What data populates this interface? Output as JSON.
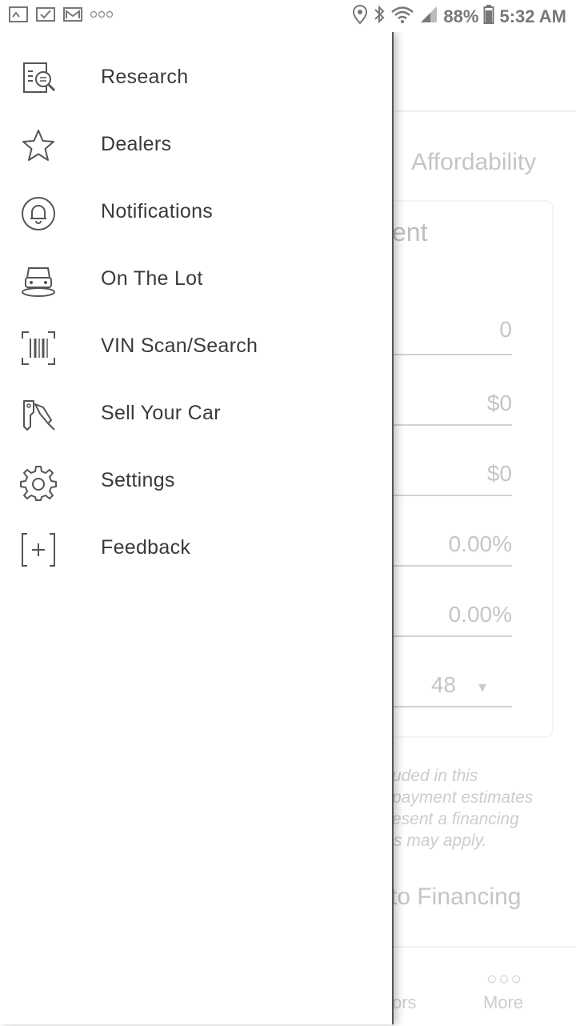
{
  "status_bar": {
    "battery": "88%",
    "time": "5:32 AM"
  },
  "drawer": {
    "items": [
      {
        "label": "Research",
        "icon": "research-icon"
      },
      {
        "label": "Dealers",
        "icon": "star-icon"
      },
      {
        "label": "Notifications",
        "icon": "bell-icon"
      },
      {
        "label": "On The Lot",
        "icon": "car-icon"
      },
      {
        "label": "VIN Scan/Search",
        "icon": "barcode-icon"
      },
      {
        "label": "Sell Your Car",
        "icon": "key-icon"
      },
      {
        "label": "Settings",
        "icon": "gear-icon"
      },
      {
        "label": "Feedback",
        "icon": "feedback-icon"
      }
    ]
  },
  "background": {
    "tab_label": "Affordability",
    "card_title_fragment": "ent",
    "fields": [
      "0",
      "$0",
      "$0",
      "0.00%",
      "0.00%",
      "48"
    ],
    "disclaimer_lines": [
      "uded in this",
      "payment estimates",
      "esent a financing",
      "s may apply."
    ],
    "financing_link": "to Financing",
    "bottom_nav": {
      "left_fragment": "ors",
      "more_label": "More"
    }
  }
}
